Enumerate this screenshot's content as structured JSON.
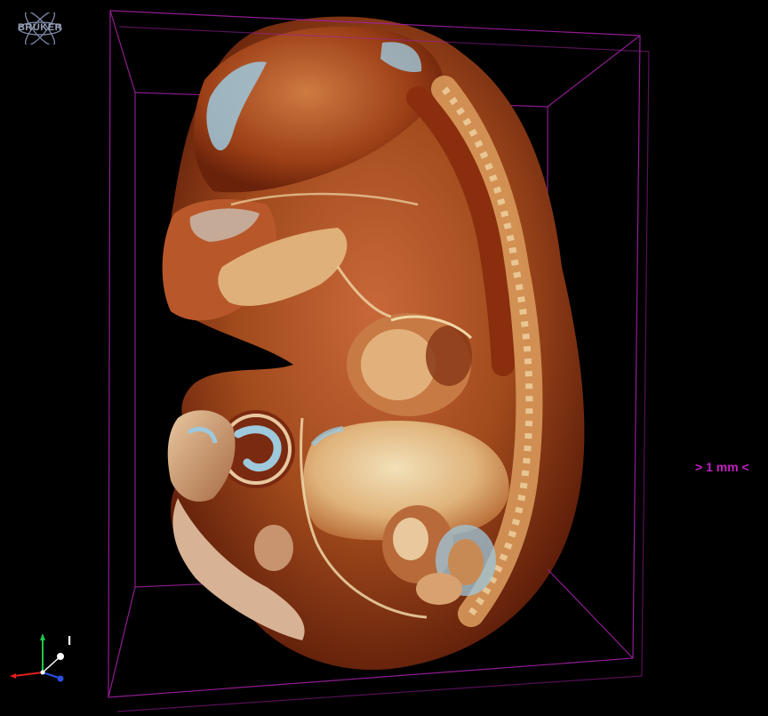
{
  "logo": {
    "text": "BRUKER",
    "icon": "atom-icon",
    "color": "#9aa2b8"
  },
  "scale_bar": {
    "label": "> 1 mm <",
    "color": "#c020c0"
  },
  "orientation": {
    "mark": "I",
    "axis_colors": {
      "x": "#e01e1e",
      "y": "#22c84a",
      "z": "#2a4fe0"
    }
  },
  "bounding_box_color": "#a020a0",
  "render": {
    "subject": "3D volume rendering of embryo, sagittal cut",
    "palette": {
      "tissue_dark": "#5a1a08",
      "tissue_mid": "#a84418",
      "tissue_light": "#d88a50",
      "highlight": "#f0d8a8",
      "cartilage": "#9ec8dc"
    }
  }
}
